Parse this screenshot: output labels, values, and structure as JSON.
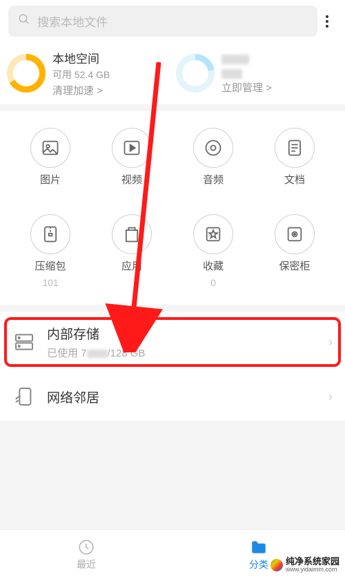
{
  "search": {
    "placeholder": "搜索本地文件"
  },
  "storage_cards": {
    "local": {
      "title": "本地空间",
      "available": "可用 52.4 GB",
      "action": "清理加速 >"
    },
    "cloud": {
      "action": "立即管理 >"
    }
  },
  "categories": [
    {
      "key": "images",
      "label": "图片",
      "count": ""
    },
    {
      "key": "videos",
      "label": "视频",
      "count": ""
    },
    {
      "key": "audio",
      "label": "音频",
      "count": ""
    },
    {
      "key": "docs",
      "label": "文档",
      "count": ""
    },
    {
      "key": "archives",
      "label": "压缩包",
      "count": "101"
    },
    {
      "key": "apps",
      "label": "应用",
      "count": ""
    },
    {
      "key": "favs",
      "label": "收藏",
      "count": "0"
    },
    {
      "key": "vault",
      "label": "保密柜",
      "count": ""
    }
  ],
  "internal_storage": {
    "title": "内部存储",
    "used_prefix": "已使用 7",
    "used_suffix": "/128 GB"
  },
  "network": {
    "title": "网络邻居"
  },
  "tabs": {
    "recent": "最近",
    "categories": "分类"
  },
  "watermark": {
    "main": "纯净系统家园",
    "sub": "www.yidaimm.com"
  }
}
